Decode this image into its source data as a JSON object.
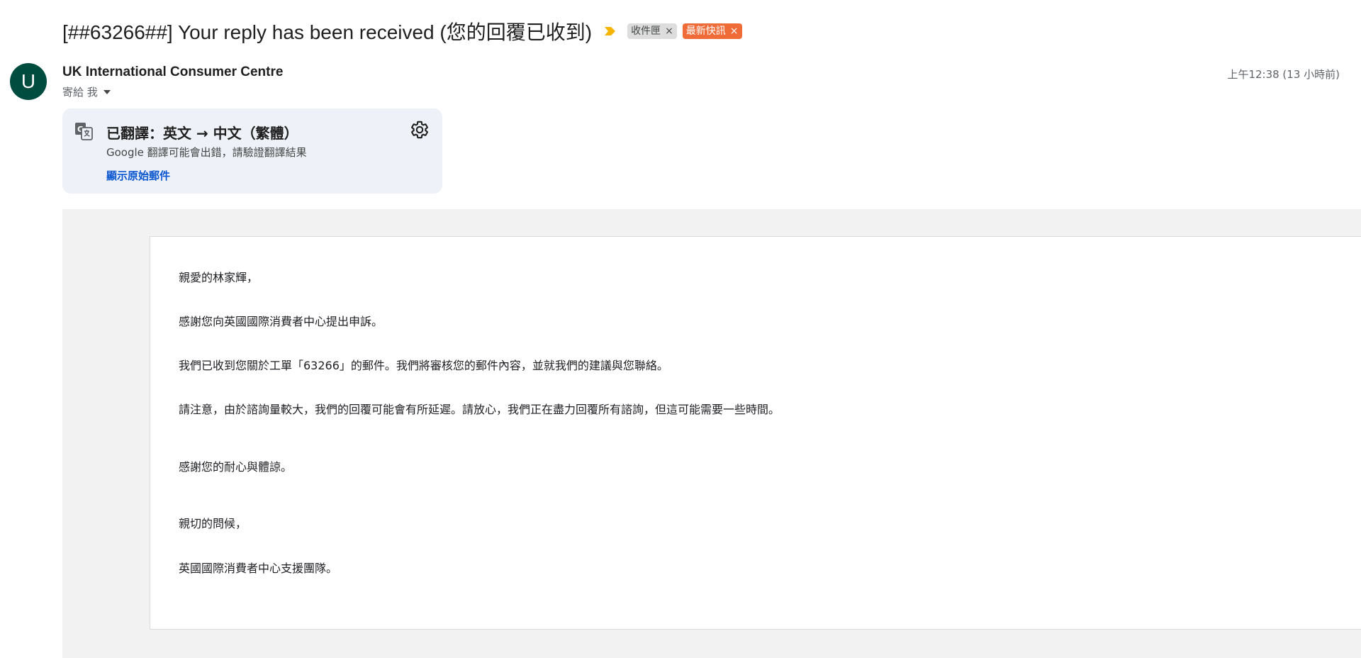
{
  "message": {
    "subject": "[##63266##] Your reply has been received (您的回覆已收到)",
    "labels": [
      {
        "name": "收件匣",
        "remove": "×"
      },
      {
        "name": "最新快訊",
        "remove": "×"
      }
    ],
    "sender": {
      "avatar_initial": "U",
      "name": "UK International Consumer Centre"
    },
    "recipient": "寄給 我",
    "timestamp": "上午12:38 (13 小時前)"
  },
  "translate_banner": {
    "title": "已翻譯：英文 → 中文（繁體）",
    "note": "Google 翻譯可能會出錯，請驗證翻譯結果",
    "show_original": "顯示原始郵件"
  },
  "body": {
    "greeting": "親愛的林家輝，",
    "para1": "感謝您向英國國際消費者中心提出申訴。",
    "para2": "我們已收到您關於工單「63266」的郵件。我們將審核您的郵件內容，並就我們的建議與您聯絡。",
    "para3": "請注意，由於諮詢量較大，我們的回覆可能會有所延遲。請放心，我們正在盡力回覆所有諮詢，但這可能需要一些時間。",
    "thanks": "感謝您的耐心與體諒。",
    "closing": "親切的問候，",
    "signature": "英國國際消費者中心支援團隊。"
  },
  "colors": {
    "avatar": "#004d40",
    "importance_marker": "#f4b400",
    "updates_label": "#ef6c39",
    "inbox_label": "#dddddd",
    "link": "#0b57d0",
    "banner_bg": "#eef2f8"
  },
  "icons": {
    "importance": "importance-marker-icon",
    "translate": "translate-icon",
    "settings": "gear-icon",
    "recipient_details": "chevron-down-icon"
  }
}
